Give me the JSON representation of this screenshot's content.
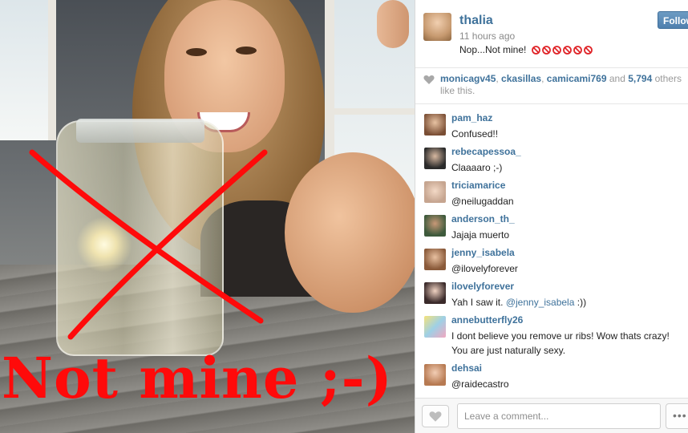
{
  "photo": {
    "overlay_text": "Not mine ;-)",
    "accent_color": "#ff0a0a"
  },
  "post": {
    "username": "thalia",
    "time": "11 hours ago",
    "caption": "Nop...Not mine!",
    "caption_icons": [
      "no-entry-icon",
      "no-entry-icon",
      "no-entry-icon",
      "no-entry-icon",
      "no-entry-icon",
      "no-entry-icon"
    ],
    "follow_label": "Follow"
  },
  "likes": {
    "users": [
      "monicagv45",
      "ckasillas",
      "camicami769"
    ],
    "and_text": "and",
    "count": "5,794",
    "suffix": "others like this."
  },
  "comments": [
    {
      "user": "pam_haz",
      "text": "Confused!!"
    },
    {
      "user": "rebecapessoa_",
      "text": "Claaaaro ;-)"
    },
    {
      "user": "triciamarice",
      "text": "@neilugaddan"
    },
    {
      "user": "anderson_th_",
      "text": "Jajaja muerto"
    },
    {
      "user": "jenny_isabela",
      "text": "@ilovelyforever"
    },
    {
      "user": "ilovelyforever",
      "text_before": "Yah I saw it.",
      "mention": "@jenny_isabela",
      "text_after": ":))"
    },
    {
      "user": "annebutterfly26",
      "text": "I dont believe you remove ur ribs! Wow thats crazy! You are just naturally sexy."
    },
    {
      "user": "dehsai",
      "text": "@raidecastro"
    }
  ],
  "comment_bar": {
    "placeholder": "Leave a comment...",
    "more_label": "•••"
  },
  "colors": {
    "link_blue": "#3f729b",
    "follow_button": "#4f80ae"
  }
}
